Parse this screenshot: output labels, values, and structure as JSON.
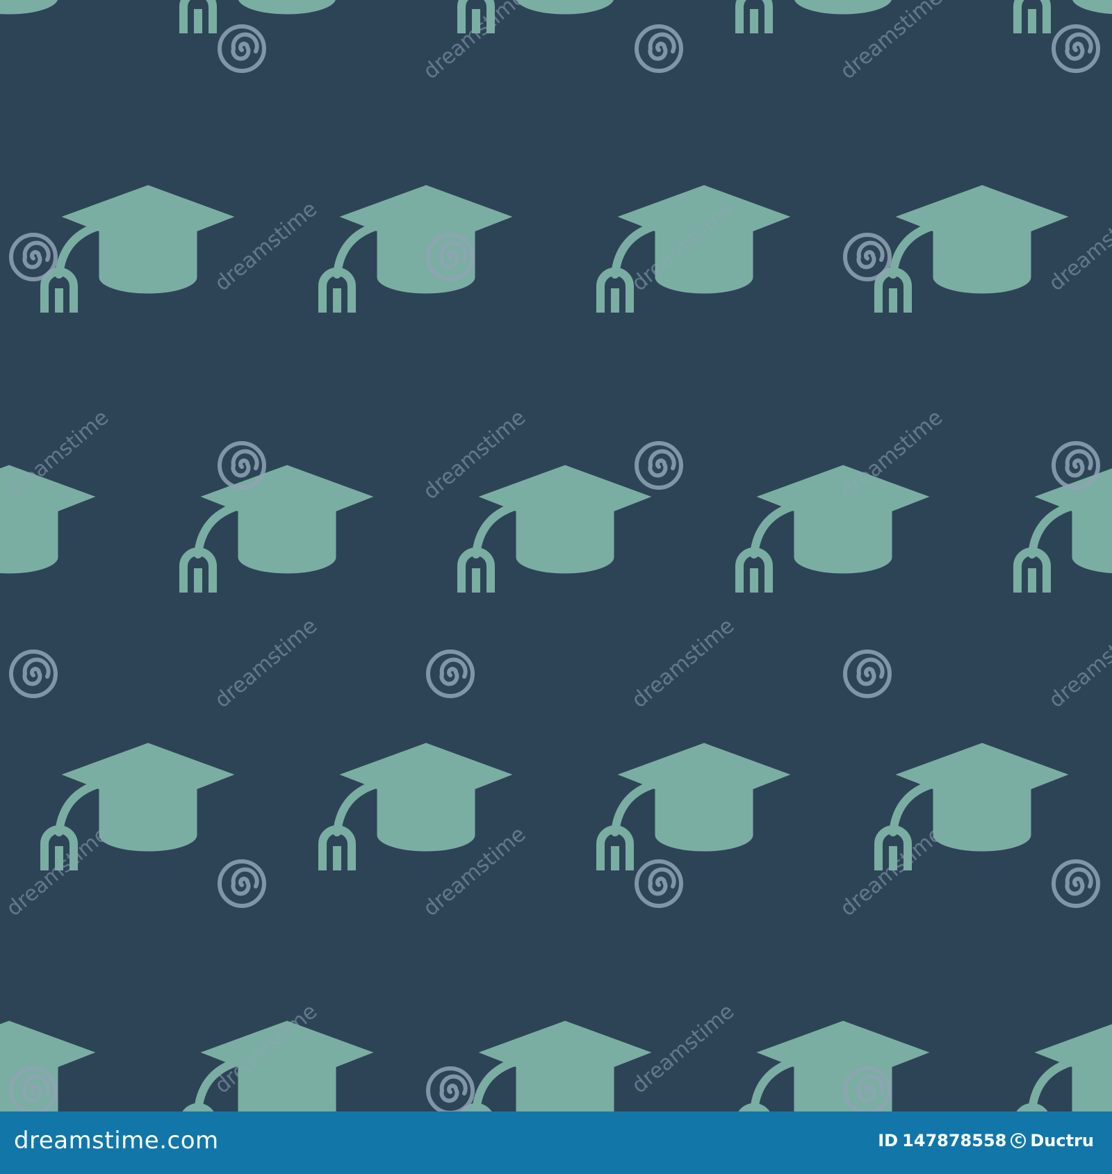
{
  "pattern": {
    "icon": "graduation-cap-icon",
    "background_color": "#2d4457",
    "icon_color": "#7aaea2",
    "watermark_color": "#8fa4b4"
  },
  "watermark": {
    "text": "dreamstime",
    "icon": "dreamstime-spiral-logo"
  },
  "footer": {
    "site": "dreamstime.com",
    "id_label": "ID",
    "id_value": "147878558",
    "author": "Ductru",
    "background_color": "#1277a8"
  }
}
